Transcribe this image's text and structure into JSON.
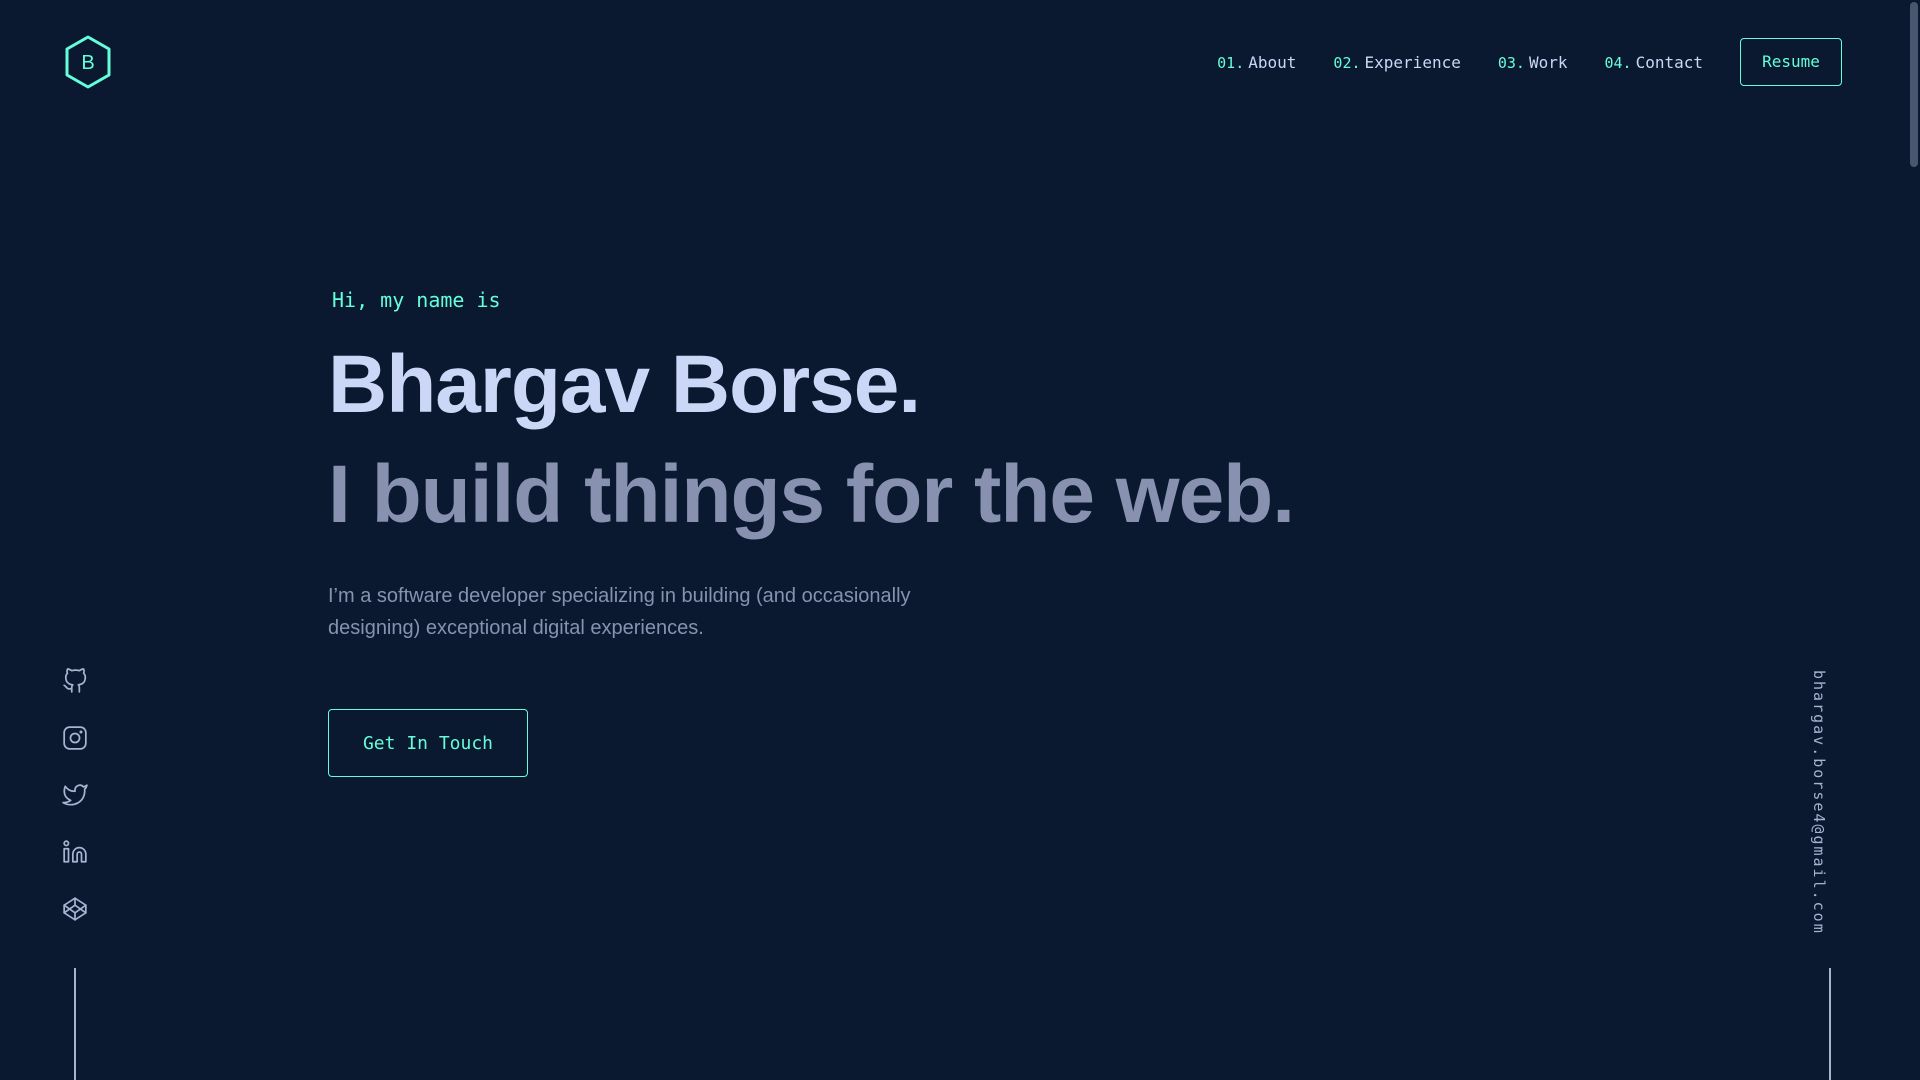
{
  "colors": {
    "background": "#0a192f",
    "accent": "#64ffda",
    "heading": "#ccd6f6",
    "muted": "#8892b0",
    "line": "#a8b2d1"
  },
  "header": {
    "logo_letter": "B",
    "nav": [
      {
        "num": "01.",
        "label": "About"
      },
      {
        "num": "02.",
        "label": "Experience"
      },
      {
        "num": "03.",
        "label": "Work"
      },
      {
        "num": "04.",
        "label": "Contact"
      }
    ],
    "resume_label": "Resume"
  },
  "hero": {
    "greeting": "Hi, my name is",
    "name": "Bhargav Borse.",
    "tagline": "I build things for the web.",
    "description": "I’m a software developer specializing in building (and occasionally designing) exceptional digital experiences.",
    "cta_label": "Get In Touch"
  },
  "socials": [
    {
      "icon": "github-icon"
    },
    {
      "icon": "instagram-icon"
    },
    {
      "icon": "twitter-icon"
    },
    {
      "icon": "linkedin-icon"
    },
    {
      "icon": "codepen-icon"
    }
  ],
  "email": "bhargav.borse4@gmail.com"
}
